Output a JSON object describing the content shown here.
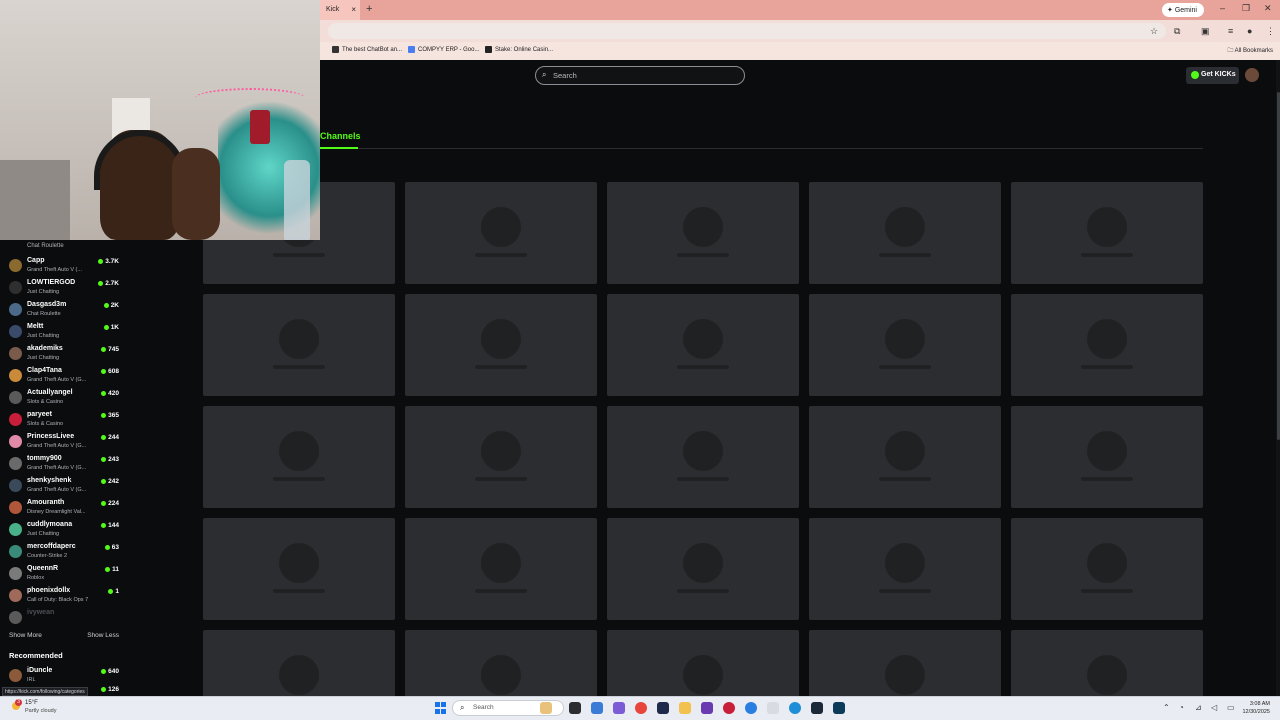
{
  "browser": {
    "tab_title": "Kick",
    "tab_close": "×",
    "new_tab": "+",
    "gemini_label": "Gemini",
    "bookmarks": [
      {
        "label": "The best ChatBot an...",
        "color": "#333333"
      },
      {
        "label": "COMPYY ERP - Goo...",
        "color": "#4a7df0"
      },
      {
        "label": "Stake: Online Casin...",
        "color": "#222222"
      }
    ],
    "all_bookmarks": "All Bookmarks"
  },
  "header": {
    "search_placeholder": "Search",
    "get_kicks": "Get KICKs"
  },
  "tabs": {
    "channels": "Channels"
  },
  "sidebar": {
    "top_category": "Chat Roulette",
    "channels": [
      {
        "name": "Capp",
        "category": "Grand Theft Auto V (...",
        "viewers": "3.7K",
        "color": "#8a6a2e"
      },
      {
        "name": "LOWTIERGOD",
        "category": "Just Chatting",
        "viewers": "2.7K",
        "color": "#2f2f2f"
      },
      {
        "name": "Dasgasd3m",
        "category": "Chat Roulette",
        "viewers": "2K",
        "color": "#4b6a8a"
      },
      {
        "name": "Meltt",
        "category": "Just Chatting",
        "viewers": "1K",
        "color": "#3a4a6a"
      },
      {
        "name": "akademiks",
        "category": "Just Chatting",
        "viewers": "745",
        "color": "#7a5a4a"
      },
      {
        "name": "Clap4Tana",
        "category": "Grand Theft Auto V (G...",
        "viewers": "608",
        "color": "#c98a3a"
      },
      {
        "name": "Actuallyangel",
        "category": "Slots & Casino",
        "viewers": "420",
        "color": "#5a5a5a"
      },
      {
        "name": "paryeet",
        "category": "Slots & Casino",
        "viewers": "365",
        "color": "#c81e3a"
      },
      {
        "name": "PrincessLivee",
        "category": "Grand Theft Auto V (G...",
        "viewers": "244",
        "color": "#e08aa8"
      },
      {
        "name": "tommy900",
        "category": "Grand Theft Auto V (G...",
        "viewers": "243",
        "color": "#6a6a6a"
      },
      {
        "name": "shenkyshenk",
        "category": "Grand Theft Auto V (G...",
        "viewers": "242",
        "color": "#3a4a5a"
      },
      {
        "name": "Amouranth",
        "category": "Disney Dreamlight Val...",
        "viewers": "224",
        "color": "#b0563a"
      },
      {
        "name": "cuddlymoana",
        "category": "Just Chatting",
        "viewers": "144",
        "color": "#4ab08a"
      },
      {
        "name": "mercoffdaperc",
        "category": "Counter-Strike 2",
        "viewers": "63",
        "color": "#3a8a7a"
      },
      {
        "name": "QueennR",
        "category": "Roblox",
        "viewers": "11",
        "color": "#7a7a7a"
      },
      {
        "name": "phoenixdollx",
        "category": "Call of Duty: Black Ops 7",
        "viewers": "1",
        "color": "#a06a5a"
      },
      {
        "name": "ivywean",
        "category": "",
        "viewers": "",
        "color": "#5a5a5a"
      }
    ],
    "show_more": "Show More",
    "show_less": "Show Less",
    "recommended_heading": "Recommended",
    "recommended": [
      {
        "name": "iDuncle",
        "category": "IRL",
        "viewers": "640",
        "color": "#8a5a3a"
      },
      {
        "name": "",
        "category": "",
        "viewers": "126",
        "color": "#5a5a5a"
      }
    ],
    "url_tooltip": "https://kick.com/following/categories"
  },
  "taskbar": {
    "temperature": "15°F",
    "condition": "Partly cloudy",
    "notification_count": "3",
    "search_placeholder": "Search",
    "time": "3:08 AM",
    "date": "12/30/2025"
  }
}
